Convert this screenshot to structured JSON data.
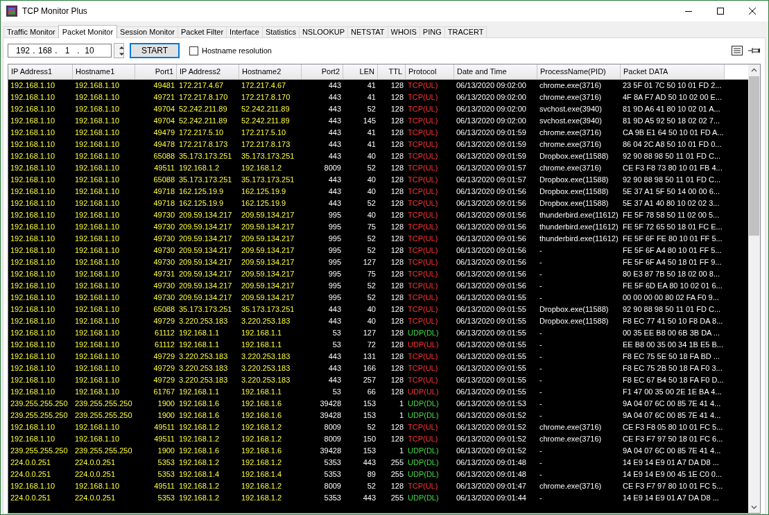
{
  "window": {
    "title": "TCP Monitor Plus"
  },
  "tabs": [
    {
      "label": "Traffic Monitor",
      "selected": false
    },
    {
      "label": "Packet Monitor",
      "selected": true
    },
    {
      "label": "Session Monitor",
      "selected": false
    },
    {
      "label": "Packet Filter",
      "selected": false
    },
    {
      "label": "Interface",
      "selected": false
    },
    {
      "label": "Statistics",
      "selected": false
    },
    {
      "label": "NSLOOKUP",
      "selected": false
    },
    {
      "label": "NETSTAT",
      "selected": false
    },
    {
      "label": "WHOIS",
      "selected": false
    },
    {
      "label": "PING",
      "selected": false
    },
    {
      "label": "TRACERT",
      "selected": false
    }
  ],
  "toolbar": {
    "ip_octets": [
      "192",
      "168",
      "1",
      "10"
    ],
    "ip_separator": ".",
    "start_button": "START",
    "hostname_resolution": {
      "label": "Hostname resolution",
      "checked": false
    }
  },
  "table": {
    "columns": [
      "IP Address1",
      "Hostname1",
      "Port1",
      "IP Address2",
      "Hostname2",
      "Port2",
      "LEN",
      "TTL",
      "Protocol",
      "Date and Time",
      "ProcessName(PID)",
      "Packet DATA"
    ],
    "rows": [
      {
        "color": "#ff3333",
        "cells": [
          "192.168.1.10",
          "192.168.1.10",
          "49481",
          "172.217.4.67",
          "172.217.4.67",
          "443",
          "41",
          "128",
          "TCP(UL)",
          "06/13/2020 09:02:00",
          "chrome.exe(3716)",
          "23 5F 01 7C 50 10 01 FD 2..."
        ]
      },
      {
        "color": "#ff3333",
        "cells": [
          "192.168.1.10",
          "192.168.1.10",
          "49721",
          "172.217.8.170",
          "172.217.8.170",
          "443",
          "41",
          "128",
          "TCP(UL)",
          "06/13/2020 09:02:00",
          "chrome.exe(3716)",
          "4F 8A F7 AD 50 10 02 00 E..."
        ]
      },
      {
        "color": "#ff3333",
        "cells": [
          "192.168.1.10",
          "192.168.1.10",
          "49704",
          "52.242.211.89",
          "52.242.211.89",
          "443",
          "52",
          "128",
          "TCP(UL)",
          "06/13/2020 09:02:00",
          "svchost.exe(3940)",
          "81 9D A6 41 80 10 02 01 A..."
        ]
      },
      {
        "color": "#ff3333",
        "cells": [
          "192.168.1.10",
          "192.168.1.10",
          "49704",
          "52.242.211.89",
          "52.242.211.89",
          "443",
          "145",
          "128",
          "TCP(UL)",
          "06/13/2020 09:02:00",
          "svchost.exe(3940)",
          "81 9D A5 92 50 18 02 02 7..."
        ]
      },
      {
        "color": "#ff3333",
        "cells": [
          "192.168.1.10",
          "192.168.1.10",
          "49479",
          "172.217.5.10",
          "172.217.5.10",
          "443",
          "41",
          "128",
          "TCP(UL)",
          "06/13/2020 09:01:59",
          "chrome.exe(3716)",
          "CA 9B E1 64 50 10 01 FD A..."
        ]
      },
      {
        "color": "#ff3333",
        "cells": [
          "192.168.1.10",
          "192.168.1.10",
          "49478",
          "172.217.8.173",
          "172.217.8.173",
          "443",
          "41",
          "128",
          "TCP(UL)",
          "06/13/2020 09:01:59",
          "chrome.exe(3716)",
          "86 04 2C A8 50 10 01 FD 0..."
        ]
      },
      {
        "color": "#ff3333",
        "cells": [
          "192.168.1.10",
          "192.168.1.10",
          "65088",
          "35.173.173.251",
          "35.173.173.251",
          "443",
          "40",
          "128",
          "TCP(UL)",
          "06/13/2020 09:01:59",
          "Dropbox.exe(11588)",
          "92 90 88 98 50 11 01 FD C..."
        ]
      },
      {
        "color": "#ff3333",
        "cells": [
          "192.168.1.10",
          "192.168.1.10",
          "49511",
          "192.168.1.2",
          "192.168.1.2",
          "8009",
          "52",
          "128",
          "TCP(UL)",
          "06/13/2020 09:01:57",
          "chrome.exe(3716)",
          "CE F3 F8 73 80 10 01 FB 4..."
        ]
      },
      {
        "color": "#ff3333",
        "cells": [
          "192.168.1.10",
          "192.168.1.10",
          "65088",
          "35.173.173.251",
          "35.173.173.251",
          "443",
          "40",
          "128",
          "TCP(UL)",
          "06/13/2020 09:01:57",
          "Dropbox.exe(11588)",
          "92 90 88 98 50 11 01 FD C..."
        ]
      },
      {
        "color": "#ff3333",
        "cells": [
          "192.168.1.10",
          "192.168.1.10",
          "49718",
          "162.125.19.9",
          "162.125.19.9",
          "443",
          "40",
          "128",
          "TCP(UL)",
          "06/13/2020 09:01:56",
          "Dropbox.exe(11588)",
          "5E 37 A1 5F 50 14 00 00 6..."
        ]
      },
      {
        "color": "#ff3333",
        "cells": [
          "192.168.1.10",
          "192.168.1.10",
          "49718",
          "162.125.19.9",
          "162.125.19.9",
          "443",
          "52",
          "128",
          "TCP(UL)",
          "06/13/2020 09:01:56",
          "Dropbox.exe(11588)",
          "5E 37 A1 40 80 10 02 02 3..."
        ]
      },
      {
        "color": "#ff3333",
        "cells": [
          "192.168.1.10",
          "192.168.1.10",
          "49730",
          "209.59.134.217",
          "209.59.134.217",
          "995",
          "40",
          "128",
          "TCP(UL)",
          "06/13/2020 09:01:56",
          "thunderbird.exe(11612)",
          "FE 5F 78 58 50 11 02 00 5..."
        ]
      },
      {
        "color": "#ff3333",
        "cells": [
          "192.168.1.10",
          "192.168.1.10",
          "49730",
          "209.59.134.217",
          "209.59.134.217",
          "995",
          "75",
          "128",
          "TCP(UL)",
          "06/13/2020 09:01:56",
          "thunderbird.exe(11612)",
          "FE 5F 72 65 50 18 01 FC E..."
        ]
      },
      {
        "color": "#ff3333",
        "cells": [
          "192.168.1.10",
          "192.168.1.10",
          "49730",
          "209.59.134.217",
          "209.59.134.217",
          "995",
          "52",
          "128",
          "TCP(UL)",
          "06/13/2020 09:01:56",
          "thunderbird.exe(11612)",
          "FE 5F 6F FE 80 10 01 FF 5..."
        ]
      },
      {
        "color": "#ff3333",
        "cells": [
          "192.168.1.10",
          "192.168.1.10",
          "49730",
          "209.59.134.217",
          "209.59.134.217",
          "995",
          "52",
          "128",
          "TCP(UL)",
          "06/13/2020 09:01:56",
          "-",
          "FE 5F 6F A4 80 10 01 FF 5..."
        ]
      },
      {
        "color": "#ff3333",
        "cells": [
          "192.168.1.10",
          "192.168.1.10",
          "49730",
          "209.59.134.217",
          "209.59.134.217",
          "995",
          "127",
          "128",
          "TCP(UL)",
          "06/13/2020 09:01:56",
          "-",
          "FE 5F 6F A4 50 18 01 FF 9..."
        ]
      },
      {
        "color": "#ff3333",
        "cells": [
          "192.168.1.10",
          "192.168.1.10",
          "49731",
          "209.59.134.217",
          "209.59.134.217",
          "995",
          "75",
          "128",
          "TCP(UL)",
          "06/13/2020 09:01:56",
          "-",
          "80 E3 87 7B 50 18 02 00 8..."
        ]
      },
      {
        "color": "#ff3333",
        "cells": [
          "192.168.1.10",
          "192.168.1.10",
          "49730",
          "209.59.134.217",
          "209.59.134.217",
          "995",
          "52",
          "128",
          "TCP(UL)",
          "06/13/2020 09:01:56",
          "-",
          "FE 5F 6D EA 80 10 02 01 6..."
        ]
      },
      {
        "color": "#ff3333",
        "cells": [
          "192.168.1.10",
          "192.168.1.10",
          "49730",
          "209.59.134.217",
          "209.59.134.217",
          "995",
          "52",
          "128",
          "TCP(UL)",
          "06/13/2020 09:01:55",
          "-",
          "00 00 00 00 80 02 FA F0 9..."
        ]
      },
      {
        "color": "#ff3333",
        "cells": [
          "192.168.1.10",
          "192.168.1.10",
          "65088",
          "35.173.173.251",
          "35.173.173.251",
          "443",
          "40",
          "128",
          "TCP(UL)",
          "06/13/2020 09:01:55",
          "Dropbox.exe(11588)",
          "92 90 88 98 50 11 01 FD C..."
        ]
      },
      {
        "color": "#ff3333",
        "cells": [
          "192.168.1.10",
          "192.168.1.10",
          "49729",
          "3.220.253.183",
          "3.220.253.183",
          "443",
          "40",
          "128",
          "TCP(UL)",
          "06/13/2020 09:01:55",
          "Dropbox.exe(11588)",
          "F8 EC 77 41 50 10 F8 DA 8..."
        ]
      },
      {
        "color": "#44dd44",
        "cells": [
          "192.168.1.10",
          "192.168.1.10",
          "61112",
          "192.168.1.1",
          "192.168.1.1",
          "53",
          "127",
          "128",
          "UDP(DL)",
          "06/13/2020 09:01:55",
          "-",
          "00 35 EE B8 00 6B 3B DA ..."
        ]
      },
      {
        "color": "#ff3333",
        "cells": [
          "192.168.1.10",
          "192.168.1.10",
          "61112",
          "192.168.1.1",
          "192.168.1.1",
          "53",
          "72",
          "128",
          "UDP(UL)",
          "06/13/2020 09:01:55",
          "-",
          "EE B8 00 35 00 34 1B E5 B..."
        ]
      },
      {
        "color": "#ff3333",
        "cells": [
          "192.168.1.10",
          "192.168.1.10",
          "49729",
          "3.220.253.183",
          "3.220.253.183",
          "443",
          "131",
          "128",
          "TCP(UL)",
          "06/13/2020 09:01:55",
          "-",
          "F8 EC 75 5E 50 18 FA BD ..."
        ]
      },
      {
        "color": "#ff3333",
        "cells": [
          "192.168.1.10",
          "192.168.1.10",
          "49729",
          "3.220.253.183",
          "3.220.253.183",
          "443",
          "166",
          "128",
          "TCP(UL)",
          "06/13/2020 09:01:55",
          "-",
          "F8 EC 75 2B 50 18 FA F0 3..."
        ]
      },
      {
        "color": "#ff3333",
        "cells": [
          "192.168.1.10",
          "192.168.1.10",
          "49729",
          "3.220.253.183",
          "3.220.253.183",
          "443",
          "257",
          "128",
          "TCP(UL)",
          "06/13/2020 09:01:55",
          "-",
          "F8 EC 67 B4 50 18 FA F0 D..."
        ]
      },
      {
        "color": "#ff3333",
        "cells": [
          "192.168.1.10",
          "192.168.1.10",
          "61767",
          "192.168.1.1",
          "192.168.1.1",
          "53",
          "66",
          "128",
          "UDP(UL)",
          "06/13/2020 09:01:55",
          "-",
          "F1 47 00 35 00 2E 1E BA 4..."
        ]
      },
      {
        "color": "#44dd44",
        "cells": [
          "239.255.255.250",
          "239.255.255.250",
          "1900",
          "192.168.1.6",
          "192.168.1.6",
          "39428",
          "153",
          "1",
          "UDP(DL)",
          "06/13/2020 09:01:53",
          "-",
          "9A 04 07 6C 00 85 7E 41 4..."
        ]
      },
      {
        "color": "#44dd44",
        "cells": [
          "239.255.255.250",
          "239.255.255.250",
          "1900",
          "192.168.1.6",
          "192.168.1.6",
          "39428",
          "153",
          "1",
          "UDP(DL)",
          "06/13/2020 09:01:52",
          "-",
          "9A 04 07 6C 00 85 7E 41 4..."
        ]
      },
      {
        "color": "#ff3333",
        "cells": [
          "192.168.1.10",
          "192.168.1.10",
          "49511",
          "192.168.1.2",
          "192.168.1.2",
          "8009",
          "52",
          "128",
          "TCP(UL)",
          "06/13/2020 09:01:52",
          "chrome.exe(3716)",
          "CE F3 F8 05 80 10 01 FC 5..."
        ]
      },
      {
        "color": "#ff3333",
        "cells": [
          "192.168.1.10",
          "192.168.1.10",
          "49511",
          "192.168.1.2",
          "192.168.1.2",
          "8009",
          "150",
          "128",
          "TCP(UL)",
          "06/13/2020 09:01:52",
          "chrome.exe(3716)",
          "CE F3 F7 97 50 18 01 FC 6..."
        ]
      },
      {
        "color": "#44dd44",
        "cells": [
          "239.255.255.250",
          "239.255.255.250",
          "1900",
          "192.168.1.6",
          "192.168.1.6",
          "39428",
          "153",
          "1",
          "UDP(DL)",
          "06/13/2020 09:01:52",
          "-",
          "9A 04 07 6C 00 85 7E 41 4..."
        ]
      },
      {
        "color": "#44dd44",
        "cells": [
          "224.0.0.251",
          "224.0.0.251",
          "5353",
          "192.168.1.2",
          "192.168.1.2",
          "5353",
          "443",
          "255",
          "UDP(DL)",
          "06/13/2020 09:01:48",
          "-",
          "14 E9 14 E9 01 A7 DA D8 ..."
        ]
      },
      {
        "color": "#44dd44",
        "cells": [
          "224.0.0.251",
          "224.0.0.251",
          "5353",
          "192.168.1.4",
          "192.168.1.4",
          "5353",
          "89",
          "255",
          "UDP(DL)",
          "06/13/2020 09:01:48",
          "-",
          "14 E9 14 E9 00 45 1E C0 0..."
        ]
      },
      {
        "color": "#ff3333",
        "cells": [
          "192.168.1.10",
          "192.168.1.10",
          "49511",
          "192.168.1.2",
          "192.168.1.2",
          "8009",
          "52",
          "128",
          "TCP(UL)",
          "06/13/2020 09:01:47",
          "chrome.exe(3716)",
          "CE F3 F7 97 80 10 01 FC 5..."
        ]
      },
      {
        "color": "#44dd44",
        "cells": [
          "224.0.0.251",
          "224.0.0.251",
          "5353",
          "192.168.1.2",
          "192.168.1.2",
          "5353",
          "443",
          "255",
          "UDP(DL)",
          "06/13/2020 09:01:44",
          "-",
          "14 E9 14 E9 01 A7 DA D8 ..."
        ]
      }
    ]
  }
}
